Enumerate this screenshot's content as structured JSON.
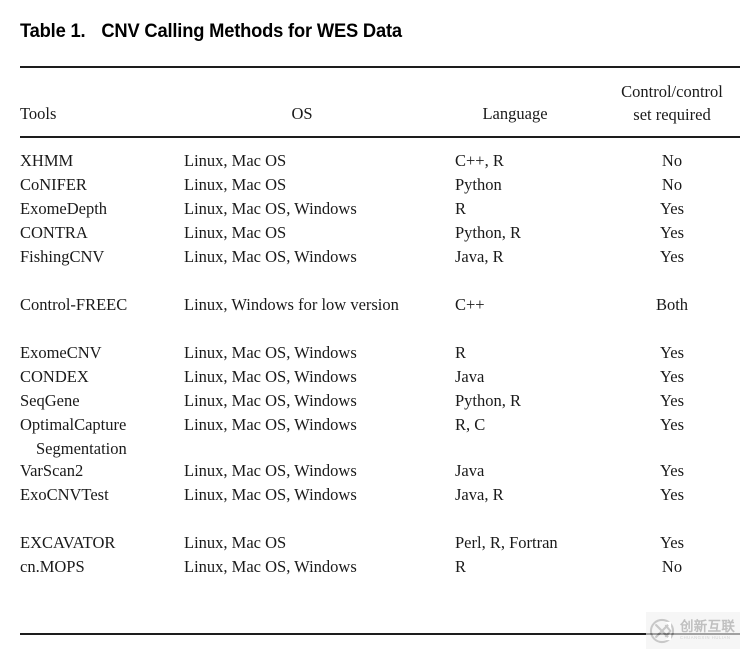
{
  "title": {
    "number": "Table 1.",
    "text": "CNV Calling Methods for WES Data"
  },
  "table": {
    "columns": [
      {
        "key": "tool",
        "label": "Tools"
      },
      {
        "key": "os",
        "label": "OS"
      },
      {
        "key": "language",
        "label": "Language"
      },
      {
        "key": "control",
        "label_line1": "Control/control",
        "label_line2": "set required"
      }
    ],
    "groups": [
      {
        "rows": [
          {
            "tool": "XHMM",
            "os": "Linux, Mac OS",
            "language": "C++, R",
            "control": "No"
          },
          {
            "tool": "CoNIFER",
            "os": "Linux, Mac OS",
            "language": "Python",
            "control": "No"
          },
          {
            "tool": "ExomeDepth",
            "os": "Linux, Mac OS, Windows",
            "language": "R",
            "control": "Yes"
          },
          {
            "tool": "CONTRA",
            "os": "Linux, Mac OS",
            "language": "Python, R",
            "control": "Yes"
          },
          {
            "tool": "FishingCNV",
            "os": "Linux, Mac OS, Windows",
            "language": "Java, R",
            "control": "Yes"
          }
        ]
      },
      {
        "rows": [
          {
            "tool": "Control-FREEC",
            "os": "Linux, Windows for low version",
            "language": "C++",
            "control": "Both"
          }
        ]
      },
      {
        "rows": [
          {
            "tool": "ExomeCNV",
            "os": "Linux, Mac OS, Windows",
            "language": "R",
            "control": "Yes"
          },
          {
            "tool": "CONDEX",
            "os": "Linux, Mac OS, Windows",
            "language": "Java",
            "control": "Yes"
          },
          {
            "tool": "SeqGene",
            "os": "Linux, Mac OS, Windows",
            "language": "Python, R",
            "control": "Yes"
          },
          {
            "tool": "OptimalCapture",
            "os": "Linux, Mac OS, Windows",
            "language": "R, C",
            "control": "Yes",
            "tool_cont": "Segmentation"
          },
          {
            "tool": "VarScan2",
            "os": "Linux, Mac OS, Windows",
            "language": "Java",
            "control": "Yes"
          },
          {
            "tool": "ExoCNVTest",
            "os": "Linux, Mac OS, Windows",
            "language": "Java, R",
            "control": "Yes"
          }
        ]
      },
      {
        "rows": [
          {
            "tool": "EXCAVATOR",
            "os": "Linux, Mac OS",
            "language": "Perl, R, Fortran",
            "control": "Yes"
          },
          {
            "tool": "cn.MOPS",
            "os": "Linux, Mac OS, Windows",
            "language": "R",
            "control": "No"
          }
        ]
      }
    ]
  },
  "watermark": {
    "chinese": "创新互联",
    "pinyin": "CHUANGXIN HULIAN",
    "logo_icon": "circled-x-logo-icon"
  }
}
